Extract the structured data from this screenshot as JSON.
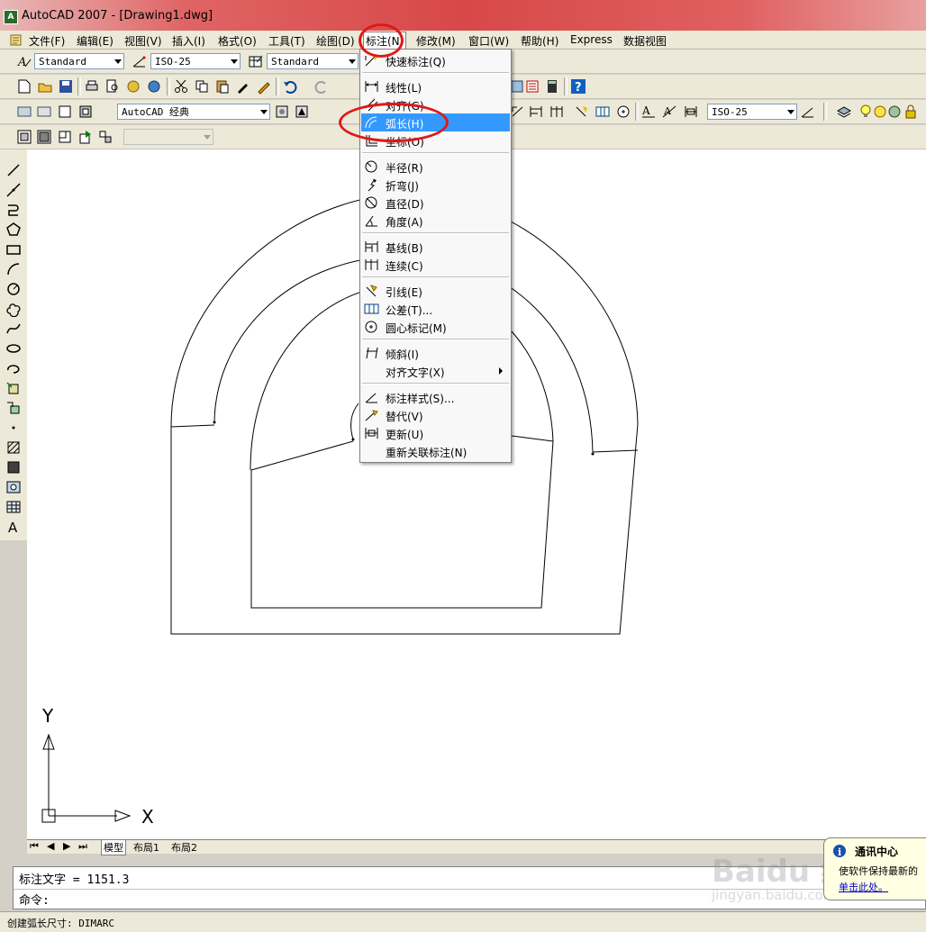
{
  "window": {
    "title": "AutoCAD 2007 - [Drawing1.dwg]"
  },
  "menubar": {
    "items": [
      "文件(F)",
      "编辑(E)",
      "视图(V)",
      "插入(I)",
      "格式(O)",
      "工具(T)",
      "绘图(D)",
      "标注(N)",
      "修改(M)",
      "窗口(W)",
      "帮助(H)",
      "Express",
      "数据视图"
    ],
    "active_index": 7
  },
  "toolbars": {
    "text_style": "Standard",
    "dim_style": "ISO-25",
    "table_style": "Standard",
    "workspace": "AutoCAD 经典",
    "dim_style_right": "ISO-25"
  },
  "dimension_menu": {
    "items": [
      {
        "label": "快速标注(Q)",
        "icon": "quick-dimension-icon"
      },
      {
        "sep": true
      },
      {
        "label": "线性(L)",
        "icon": "linear-dimension-icon"
      },
      {
        "label": "对齐(G)",
        "icon": "aligned-dimension-icon"
      },
      {
        "label": "弧长(H)",
        "icon": "arc-length-icon",
        "highlighted": true
      },
      {
        "label": "坐标(O)",
        "icon": "ordinate-icon"
      },
      {
        "sep": true
      },
      {
        "label": "半径(R)",
        "icon": "radius-icon"
      },
      {
        "label": "折弯(J)",
        "icon": "jogged-icon"
      },
      {
        "label": "直径(D)",
        "icon": "diameter-icon"
      },
      {
        "label": "角度(A)",
        "icon": "angular-icon"
      },
      {
        "sep": true
      },
      {
        "label": "基线(B)",
        "icon": "baseline-icon"
      },
      {
        "label": "连续(C)",
        "icon": "continue-icon"
      },
      {
        "sep": true
      },
      {
        "label": "引线(E)",
        "icon": "leader-icon"
      },
      {
        "label": "公差(T)...",
        "icon": "tolerance-icon"
      },
      {
        "label": "圆心标记(M)",
        "icon": "center-mark-icon"
      },
      {
        "sep": true
      },
      {
        "label": "倾斜(I)",
        "icon": "oblique-icon"
      },
      {
        "label": "对齐文字(X)",
        "icon": "",
        "submenu": true
      },
      {
        "sep": true
      },
      {
        "label": "标注样式(S)...",
        "icon": "dimension-style-icon"
      },
      {
        "label": "替代(V)",
        "icon": "override-icon"
      },
      {
        "label": "更新(U)",
        "icon": "update-icon"
      },
      {
        "label": "重新关联标注(N)",
        "icon": ""
      }
    ]
  },
  "canvas": {
    "ucs_y": "Y",
    "ucs_x": "X"
  },
  "layout_tabs": [
    "模型",
    "布局1",
    "布局2"
  ],
  "command": {
    "history": "标注文字 = 1151.3",
    "prompt": "命令:"
  },
  "status": {
    "text": "创建弧长尺寸: DIMARC"
  },
  "comm_center": {
    "title": "通讯中心",
    "body": "使软件保持最新的",
    "link": "单击此处。"
  },
  "watermark": {
    "brand": "Baidu 经验",
    "url": "jingyan.baidu.com"
  },
  "colors": {
    "highlight": "#3399ff",
    "annotation": "#e01818",
    "titlebar": "#d84848"
  }
}
